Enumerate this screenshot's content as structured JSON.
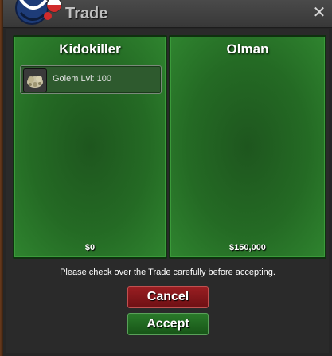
{
  "window": {
    "title": "Trade",
    "close_glyph": "✕"
  },
  "left_panel": {
    "player_name": "Kidokiller",
    "money": "$0",
    "items": [
      {
        "icon": "golem-icon",
        "label": "Golem  Lvl: 100"
      }
    ]
  },
  "right_panel": {
    "player_name": "Olman",
    "money": "$150,000"
  },
  "note": "Please check over the Trade carefully before accepting.",
  "buttons": {
    "cancel": "Cancel",
    "accept": "Accept"
  },
  "colors": {
    "panel_green": "#246a24",
    "cancel_red": "#8a1a1e",
    "accept_green": "#1f6a1f"
  }
}
